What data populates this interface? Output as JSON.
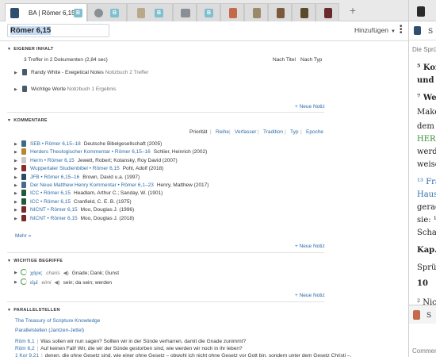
{
  "tabs": [
    {
      "label": "BA | Römer 6,15",
      "badge": "B",
      "active": true
    },
    {
      "badge": "B"
    },
    {
      "badge": "B"
    },
    {
      "badge": "B"
    }
  ],
  "search": {
    "reference": "Römer 6,15",
    "add_label": "Hinzufügen"
  },
  "own_content": {
    "heading": "EIGENER INHALT",
    "summary": "3 Treffer in 2 Dokumenten (2,84 sec)",
    "sort_title": "Nach Titel",
    "sort_type": "Nach Typ",
    "items": [
      {
        "title": "Randy White - Exegetical Notes",
        "kind": "Notizbuch",
        "count": "2 Treffer"
      },
      {
        "title": "Wichtige Worte",
        "kind": "Notizbuch",
        "count": "1 Ergebnis"
      }
    ],
    "new_note": "+ Neue Notiz"
  },
  "commentaries": {
    "heading": "KOMMENTARE",
    "sort_options": [
      "Priorität",
      "Reihe",
      "Verfasser",
      "Tradition",
      "Typ",
      "Epoche"
    ],
    "items": [
      {
        "title": "SEB • Römer 6,15–18",
        "detail": "Deutsche Bibelgesellschaft (2005)",
        "color": "#3a6b8a"
      },
      {
        "title": "Herders Theologischer Kommentar • Römer 6,15–16",
        "detail": "Schlier, Heinrich (2002)",
        "color": "#b8862e"
      },
      {
        "title": "Herm • Römer 6,15",
        "detail": "Jewett, Robert; Kotansky, Roy David (2007)",
        "color": "#c9c9c9"
      },
      {
        "title": "Wuppertaler Studienbibel • Römer 6,15",
        "detail": "Pohl, Adolf (2018)",
        "color": "#8a2a2a"
      },
      {
        "title": "JFB • Römer 6,15–16",
        "detail": "Brown, David u.a. (1997)",
        "color": "#2a4a6a"
      },
      {
        "title": "Der Neue Matthew Henry Kommentar • Römer 6,1–23",
        "detail": "Henry, Matthew (2017)",
        "color": "#4a6a8a"
      },
      {
        "title": "ICC • Römer 6,15",
        "detail": "Headlam, Arthur C.; Sanday, W. (1901)",
        "color": "#1f5a3a"
      },
      {
        "title": "ICC • Römer 6,15",
        "detail": "Cranfield, C. E. B. (1975)",
        "color": "#1f5a3a"
      },
      {
        "title": "NICNT • Römer 6,15",
        "detail": "Moo, Douglas J. (1996)",
        "color": "#7a2a2a"
      },
      {
        "title": "NICNT • Römer 6,15",
        "detail": "Moo, Douglas J. (2018)",
        "color": "#7a2a2a"
      }
    ],
    "more": "Mehr »",
    "new_note": "+ Neue Notiz"
  },
  "key_terms": {
    "heading": "WICHTIGE BEGRIFFE",
    "items": [
      {
        "greek": "χάρις",
        "translit": "charis",
        "meaning": "Gnade; Dank; Gunst"
      },
      {
        "greek": "εἰμί",
        "translit": "eimi",
        "meaning": "sein; da sein; werden"
      }
    ],
    "new_note": "+ Neue Notiz"
  },
  "parallels": {
    "heading": "PARALLELSTELLEN",
    "sources": [
      "The Treasury of Scripture Knowledge",
      "Parallelstellen (Jantzen-Jettel)"
    ],
    "verses": [
      {
        "ref": "Röm 6,1",
        "text": "Was sollen wir nun sagen? Sollten wir in der Sünde verharren, damit die Gnade zunimmt?"
      },
      {
        "ref": "Röm 6,2",
        "text": "Auf keinen Fall! Wir, die wir der Sünde gestorben sind, wie werden wir noch in ihr leben?"
      },
      {
        "ref": "1 Kor 9,21",
        "text": "denen, die ohne Gesetz sind, wie einer ohne Gesetz – obwohl ich nicht ohne Gesetz vor Gott bin, sondern unter dem Gesetz Christi –,"
      }
    ]
  },
  "right_panel": {
    "search_label": "S",
    "hint": "Die Sprü",
    "lines": [
      {
        "t": "⁵ Kor",
        "cls": "",
        "bold": true
      },
      {
        "t": "und l",
        "cls": "",
        "bold": true
      },
      {
        "t": "⁷ Wer",
        "cls": "",
        "bold": true
      },
      {
        "t": "Make",
        "cls": "",
        "bold": false
      },
      {
        "t": "dem",
        "cls": "",
        "bold": false
      },
      {
        "t": "HERR",
        "cls": "herr",
        "bold": false
      },
      {
        "t": "werde",
        "cls": "",
        "bold": false
      },
      {
        "t": "weise",
        "cls": "",
        "bold": false
      },
      {
        "t": "¹³ Fra",
        "cls": "rblue",
        "bold": false
      },
      {
        "t": "Haus",
        "cls": "rblue",
        "bold": false
      },
      {
        "t": "gerad",
        "cls": "",
        "bold": false
      },
      {
        "t": "sie: ¹⁷",
        "cls": "",
        "bold": false
      },
      {
        "t": "Schat",
        "cls": "",
        "bold": false
      },
      {
        "t": "Kap.",
        "cls": "",
        "bold": true
      },
      {
        "t": "Sprüc",
        "cls": "",
        "bold": false
      },
      {
        "t": "10",
        "cls": "",
        "bold": true
      },
      {
        "t": "² Nich",
        "cls": "",
        "bold": false
      }
    ],
    "bottom_label": "S",
    "comment": "Commen"
  }
}
